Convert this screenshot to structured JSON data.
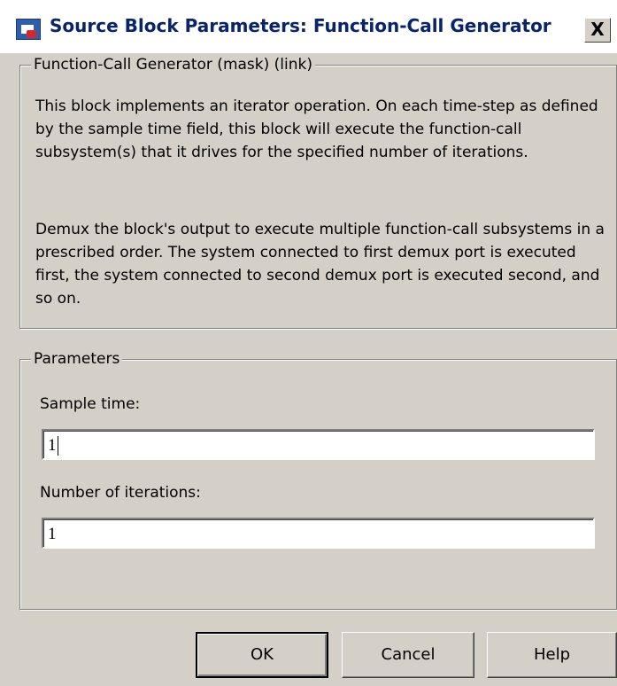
{
  "window": {
    "title": "Source Block Parameters: Function-Call Generator",
    "close_label": "X"
  },
  "description": {
    "legend": "Function-Call Generator (mask) (link)",
    "paragraphs": [
      "This block implements an iterator operation. On each time-step as defined by the sample time field, this block will execute the function-call subsystem(s) that it drives for the specified number of iterations.",
      "Demux the block's output to execute multiple function-call subsystems in a prescribed order.  The system connected to first demux port is executed first, the system connected to second demux port is executed second, and so on."
    ]
  },
  "parameters": {
    "legend": "Parameters",
    "sample_time": {
      "label": "Sample time:",
      "value": "1"
    },
    "iterations": {
      "label": "Number of iterations:",
      "value": "1"
    }
  },
  "buttons": {
    "ok": "OK",
    "cancel": "Cancel",
    "help": "Help"
  }
}
